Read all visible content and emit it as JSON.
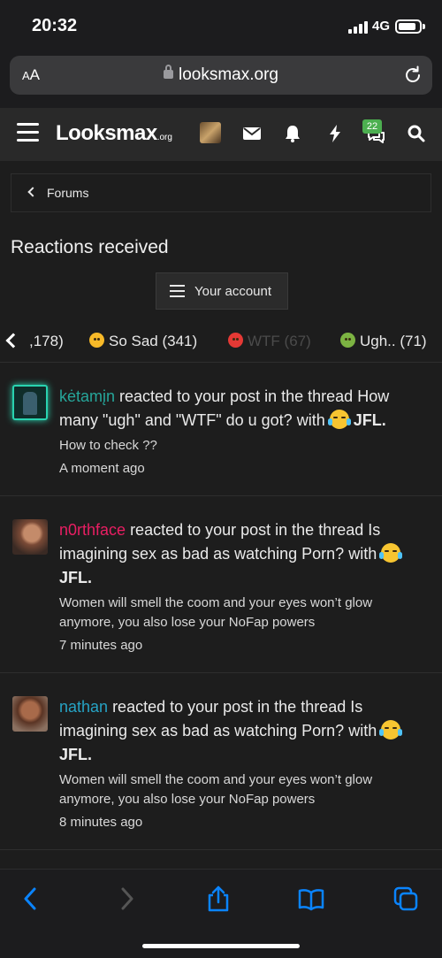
{
  "status": {
    "time": "20:32",
    "network": "4G"
  },
  "browser": {
    "aa_label_small": "A",
    "aa_label_large": "A",
    "url": "looksmax.org"
  },
  "header": {
    "logo_main": "Looksmax",
    "logo_suffix": ".org",
    "notification_badge": "22"
  },
  "breadcrumb": {
    "label": "Forums"
  },
  "page": {
    "title": "Reactions received",
    "account_button": "Your account"
  },
  "tabs": [
    {
      "label": ",178)",
      "emoji": ""
    },
    {
      "label": "So Sad (341)",
      "emoji": "sad"
    },
    {
      "label": "WTF (67)",
      "emoji": "wtf"
    },
    {
      "label": "Ugh.. (71)",
      "emoji": "ugh"
    }
  ],
  "reactions": [
    {
      "user": "kėtamįn",
      "text_before": " reacted to your post in the thread How many \"ugh\" and \"WTF\" do u got? with ",
      "reaction": "JFL.",
      "snippet": "How to check ??",
      "time": "A moment ago"
    },
    {
      "user": "n0rthface",
      "text_before": " reacted to your post in the thread Is imagining sex as bad as watching Porn? with ",
      "reaction": "JFL.",
      "snippet": "Women will smell the coom and your eyes won’t glow anymore, you also lose your NoFap powers",
      "time": "7 minutes ago"
    },
    {
      "user": "nathan",
      "text_before": " reacted to your post in the thread Is imagining sex as bad as watching Porn? with ",
      "reaction": "JFL.",
      "snippet": "Women will smell the coom and your eyes won’t glow anymore, you also lose your NoFap powers",
      "time": "8 minutes ago"
    }
  ],
  "colors": {
    "accent_teal": "#26a69a",
    "accent_pink": "#e91e63",
    "accent_blue": "#26a3c4",
    "badge_green": "#4caf50",
    "safari_blue": "#0a84ff"
  },
  "icons": [
    "menu-icon",
    "envelope-icon",
    "bell-icon",
    "bolt-icon",
    "chat-icon",
    "search-icon",
    "lock-icon",
    "reload-icon",
    "back-icon",
    "forward-icon",
    "share-icon",
    "bookmarks-icon",
    "tabs-icon"
  ]
}
